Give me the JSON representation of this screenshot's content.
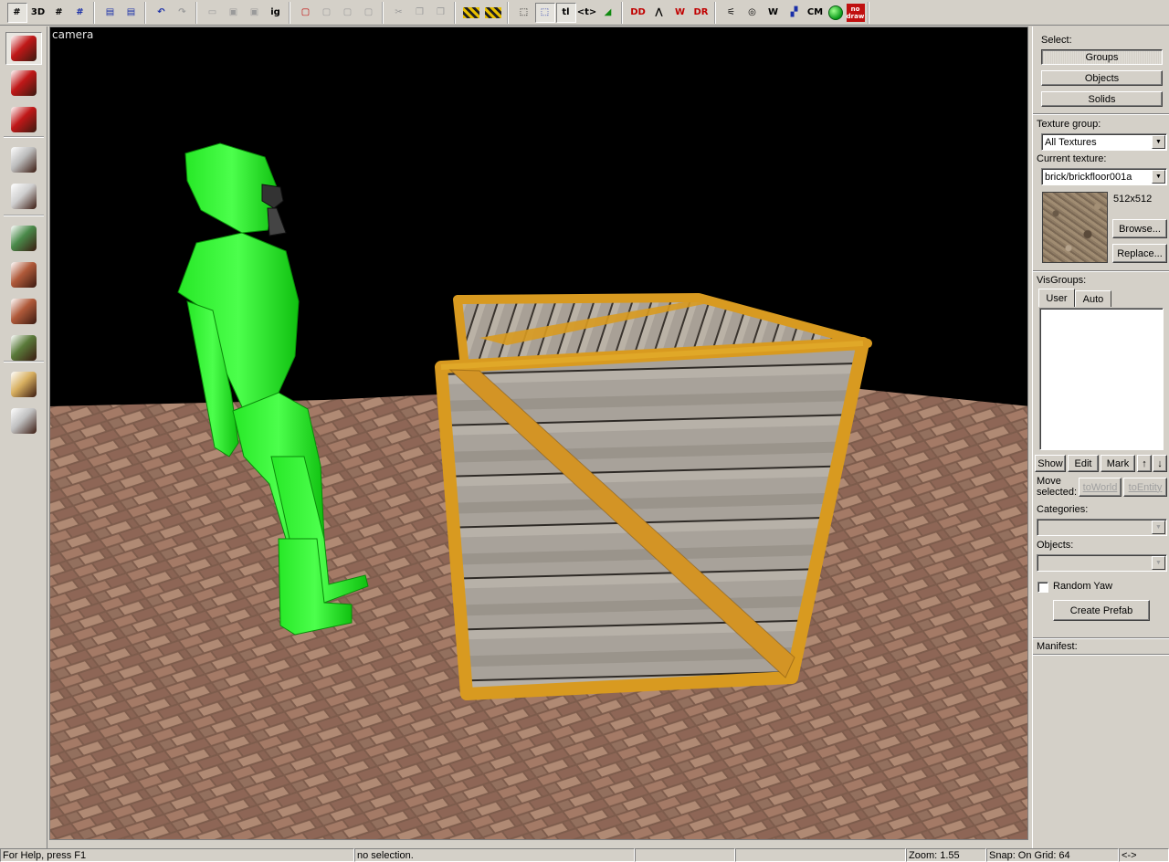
{
  "toolbar": {
    "items": [
      {
        "name": "grid-toggle-button",
        "glyph": "#"
      },
      {
        "name": "3d-grid-button",
        "glyph": "3D"
      },
      {
        "name": "grid-smaller-button",
        "glyph": "#"
      },
      {
        "name": "grid-larger-button",
        "glyph": "#"
      },
      {
        "name": "load-window-state-button",
        "glyph": "▤"
      },
      {
        "name": "save-window-state-button",
        "glyph": "▤"
      },
      {
        "name": "undo-button",
        "glyph": "↶"
      },
      {
        "name": "redo-button",
        "glyph": "↷"
      },
      {
        "name": "carve-button",
        "glyph": "▭"
      },
      {
        "name": "group-button",
        "glyph": "▣"
      },
      {
        "name": "ungroup-button",
        "glyph": "▣"
      },
      {
        "name": "ignore-groups-button",
        "glyph": "ig"
      },
      {
        "name": "hide-selected-button",
        "glyph": "▢"
      },
      {
        "name": "hide-unselected-button",
        "glyph": "▢"
      },
      {
        "name": "show-all-button",
        "glyph": "▢"
      },
      {
        "name": "create-visgroup-button",
        "glyph": "▢"
      },
      {
        "name": "cut-button",
        "glyph": "✂"
      },
      {
        "name": "copy-button",
        "glyph": "❐"
      },
      {
        "name": "paste-button",
        "glyph": "❒"
      },
      {
        "name": "toolbar-hatch-1",
        "glyph": ""
      },
      {
        "name": "toolbar-hatch-2",
        "glyph": ""
      },
      {
        "name": "selection-box-button",
        "glyph": "⬚"
      },
      {
        "name": "selection-handles-button",
        "glyph": "⬚"
      },
      {
        "name": "texture-lock-button",
        "glyph": "tl"
      },
      {
        "name": "texture-scale-lock-button",
        "glyph": "<t>"
      },
      {
        "name": "transform-button",
        "glyph": "◢"
      },
      {
        "name": "show-entity-names-button",
        "glyph": "DD"
      },
      {
        "name": "clipping-tool-button",
        "glyph": "⋀"
      },
      {
        "name": "vertex-tool-button",
        "glyph": "W"
      },
      {
        "name": "entity-report-button",
        "glyph": "DR"
      },
      {
        "name": "run-map-button",
        "glyph": "⚟"
      },
      {
        "name": "compile-button",
        "glyph": "◎"
      },
      {
        "name": "wireframe-button",
        "glyph": "W"
      },
      {
        "name": "flat-shaded-button",
        "glyph": "▞"
      },
      {
        "name": "cordon-button",
        "glyph": "CM"
      },
      {
        "name": "green-display-button",
        "glyph": ""
      },
      {
        "name": "no-draw-button",
        "glyph": "no draw"
      }
    ]
  },
  "tools": [
    {
      "name": "selection-tool",
      "active": true,
      "color": "#c01818"
    },
    {
      "name": "magnify-tool",
      "active": false,
      "color": "#c01818"
    },
    {
      "name": "camera-tool",
      "active": false,
      "color": "#c01818"
    },
    {
      "name": "entity-tool",
      "active": false,
      "color": "#bcbcbc"
    },
    {
      "name": "block-tool",
      "active": false,
      "color": "#cfcfcf"
    },
    {
      "name": "texture-application-tool",
      "active": false,
      "color": "#4a8a4a"
    },
    {
      "name": "apply-current-texture-tool",
      "active": false,
      "color": "#b05a3a"
    },
    {
      "name": "decal-tool",
      "active": false,
      "color": "#b05a3a"
    },
    {
      "name": "overlay-tool",
      "active": false,
      "color": "#5a7a3a"
    },
    {
      "name": "clip-tool",
      "active": false,
      "color": "#d8b060"
    },
    {
      "name": "vertex-tool",
      "active": false,
      "color": "#c0c0c0"
    }
  ],
  "viewport": {
    "label": "camera"
  },
  "panel": {
    "select_label": "Select:",
    "select_buttons": [
      "Groups",
      "Objects",
      "Solids"
    ],
    "texture_group_label": "Texture group:",
    "texture_group_value": "All Textures",
    "current_texture_label": "Current texture:",
    "current_texture_value": "brick/brickfloor001a",
    "texture_size": "512x512",
    "browse_label": "Browse...",
    "replace_label": "Replace...",
    "visgroups_label": "VisGroups:",
    "visgroup_tabs": [
      "User",
      "Auto"
    ],
    "vis_buttons": [
      "Show",
      "Edit",
      "Mark"
    ],
    "move_selected_label": "Move selected:",
    "to_world_label": "toWorld",
    "to_entity_label": "toEntity",
    "categories_label": "Categories:",
    "objects_label": "Objects:",
    "random_yaw_label": "Random Yaw",
    "create_prefab_label": "Create Prefab",
    "manifest_label": "Manifest:"
  },
  "status": {
    "help": "For Help, press F1",
    "selection": "no selection.",
    "zoom": "Zoom: 1.55",
    "snap": "Snap: On Grid: 64",
    "nav": "<->"
  }
}
